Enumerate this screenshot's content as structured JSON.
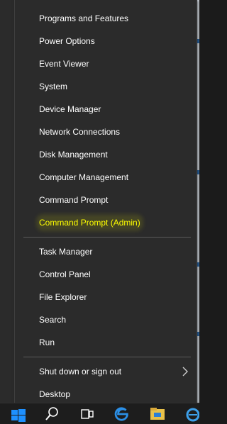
{
  "menu": {
    "groups": [
      [
        {
          "label": "Programs and Features"
        },
        {
          "label": "Power Options"
        },
        {
          "label": "Event Viewer"
        },
        {
          "label": "System"
        },
        {
          "label": "Device Manager"
        },
        {
          "label": "Network Connections"
        },
        {
          "label": "Disk Management"
        },
        {
          "label": "Computer Management"
        },
        {
          "label": "Command Prompt"
        },
        {
          "label": "Command Prompt (Admin)"
        }
      ],
      [
        {
          "label": "Task Manager"
        },
        {
          "label": "Control Panel"
        },
        {
          "label": "File Explorer"
        },
        {
          "label": "Search"
        },
        {
          "label": "Run"
        }
      ],
      [
        {
          "label": "Shut down or sign out"
        },
        {
          "label": "Desktop"
        }
      ]
    ],
    "highlighted_item": "Command Prompt (Admin)",
    "submenu_item": "Shut down or sign out"
  },
  "taskbar": {
    "icons": [
      "windows-start-icon",
      "search-icon",
      "task-view-icon",
      "edge-icon",
      "file-explorer-icon",
      "ie-icon"
    ]
  },
  "colors": {
    "menu_background": "#2b2b2b",
    "text": "#ffffff",
    "highlight_text": "#ffff00",
    "separator": "#5a5a5a",
    "start_blue": "#1e90ff"
  }
}
